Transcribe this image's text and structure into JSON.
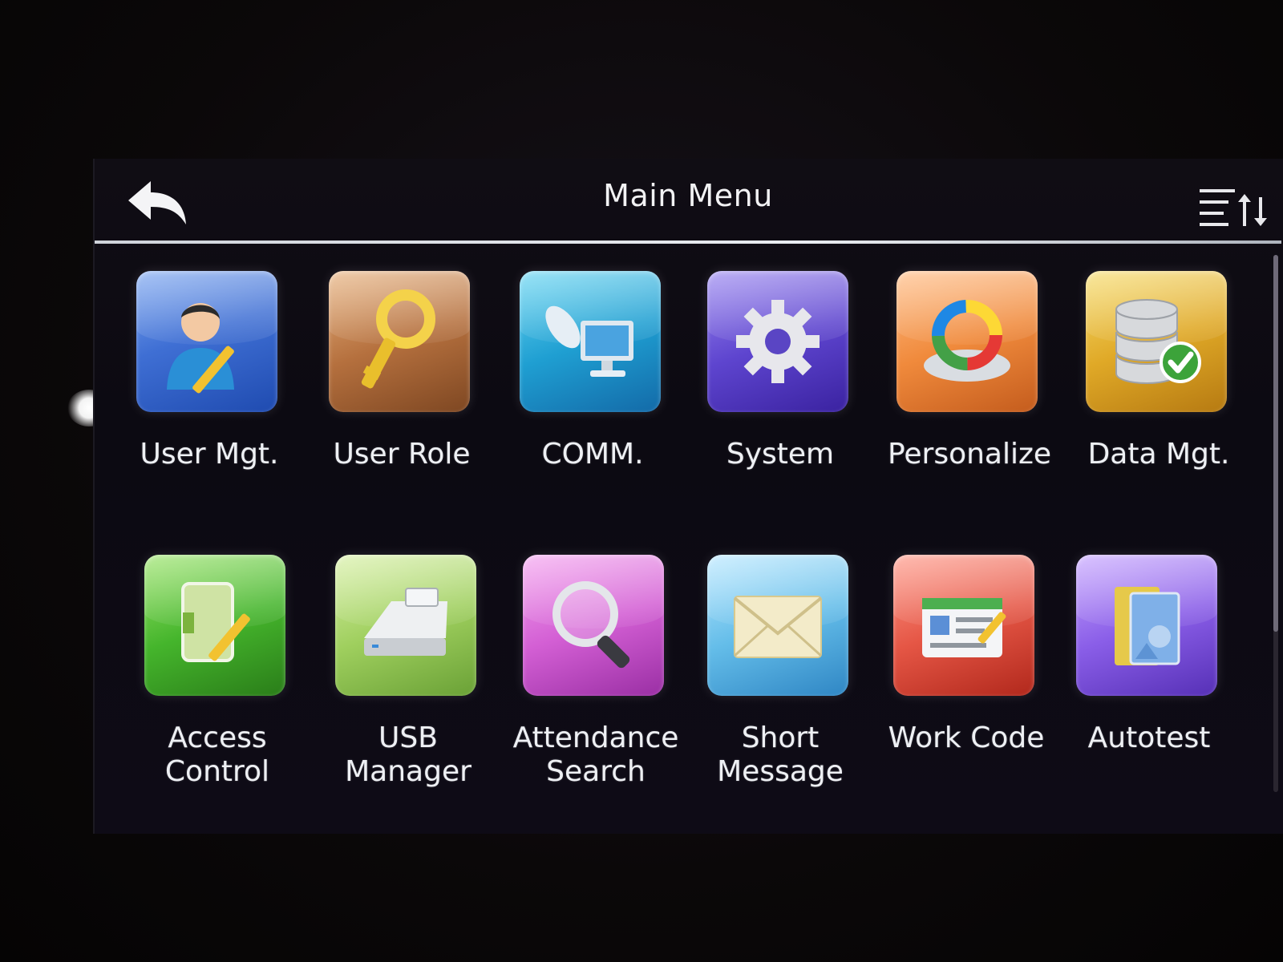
{
  "header": {
    "title": "Main Menu",
    "back_icon": "back-arrow-icon",
    "sort_icon": "sort-list-icon"
  },
  "menu": {
    "items": [
      {
        "label": "User Mgt.",
        "icon": "user-edit-icon"
      },
      {
        "label": "User Role",
        "icon": "key-icon"
      },
      {
        "label": "COMM.",
        "icon": "satellite-computer-icon"
      },
      {
        "label": "System",
        "icon": "gear-icon"
      },
      {
        "label": "Personalize",
        "icon": "color-wheel-icon"
      },
      {
        "label": "Data Mgt.",
        "icon": "database-check-icon"
      },
      {
        "label": "Access\nControl",
        "icon": "door-pencil-icon"
      },
      {
        "label": "USB\nManager",
        "icon": "usb-drive-icon"
      },
      {
        "label": "Attendance\nSearch",
        "icon": "magnifier-icon"
      },
      {
        "label": "Short\nMessage",
        "icon": "envelope-icon"
      },
      {
        "label": "Work Code",
        "icon": "id-card-icon"
      },
      {
        "label": "Autotest",
        "icon": "folder-book-icon"
      }
    ]
  }
}
